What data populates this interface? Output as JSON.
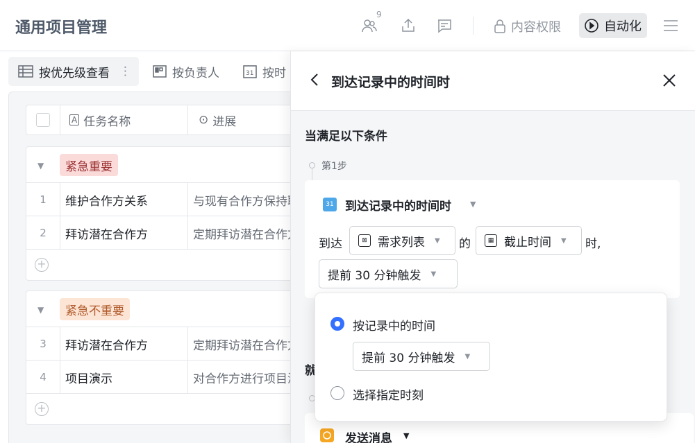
{
  "topbar": {
    "title": "通用项目管理",
    "collaborator_count": "9",
    "permission_label": "内容权限",
    "automation_label": "自动化"
  },
  "views": [
    {
      "label": "按优先级查看",
      "more": "⋮"
    },
    {
      "label": "按负责人"
    },
    {
      "label": "按时"
    }
  ],
  "table": {
    "columns": [
      {
        "icon": "A",
        "label": "任务名称"
      },
      {
        "icon": "⊙",
        "label": "进展"
      }
    ],
    "groups": [
      {
        "tag": "紧急重要",
        "tag_bg": "#fbdada",
        "tag_color": "#9a2f2f",
        "rows": [
          {
            "num": "1",
            "name": "维护合作方关系",
            "progress": "与现有合作方保持联"
          },
          {
            "num": "2",
            "name": "拜访潜在合作方",
            "progress": "定期拜访潜在合作方"
          }
        ]
      },
      {
        "tag": "紧急不重要",
        "tag_bg": "#fde5d6",
        "tag_color": "#b05a2a",
        "rows": [
          {
            "num": "3",
            "name": "拜访潜在合作方",
            "progress": "定期拜访潜在合作方"
          },
          {
            "num": "4",
            "name": "项目演示",
            "progress": "对合作方进行项目演"
          }
        ]
      }
    ],
    "add_icon": "+"
  },
  "panel": {
    "title": "到达记录中的时间时",
    "condition_title": "当满足以下条件",
    "step_label": "第1步",
    "trigger_name": "到达记录中的时间时",
    "trigger_icon_text": "31",
    "reach_label": "到达",
    "table_select": "需求列表",
    "of_label": "的",
    "field_select": "截止时间",
    "time_suffix": "时,",
    "offset_select": "提前 30 分钟触发",
    "then_title": "就",
    "action_name": "发送消息"
  },
  "popover": {
    "option1": "按记录中的时间",
    "option1_select": "提前 30 分钟触发",
    "option2": "选择指定时刻",
    "selected": "option1"
  },
  "colors": {
    "accent": "#3370ff",
    "trigger_icon": "#4ea7e8",
    "message_icon": "#f5a623"
  }
}
